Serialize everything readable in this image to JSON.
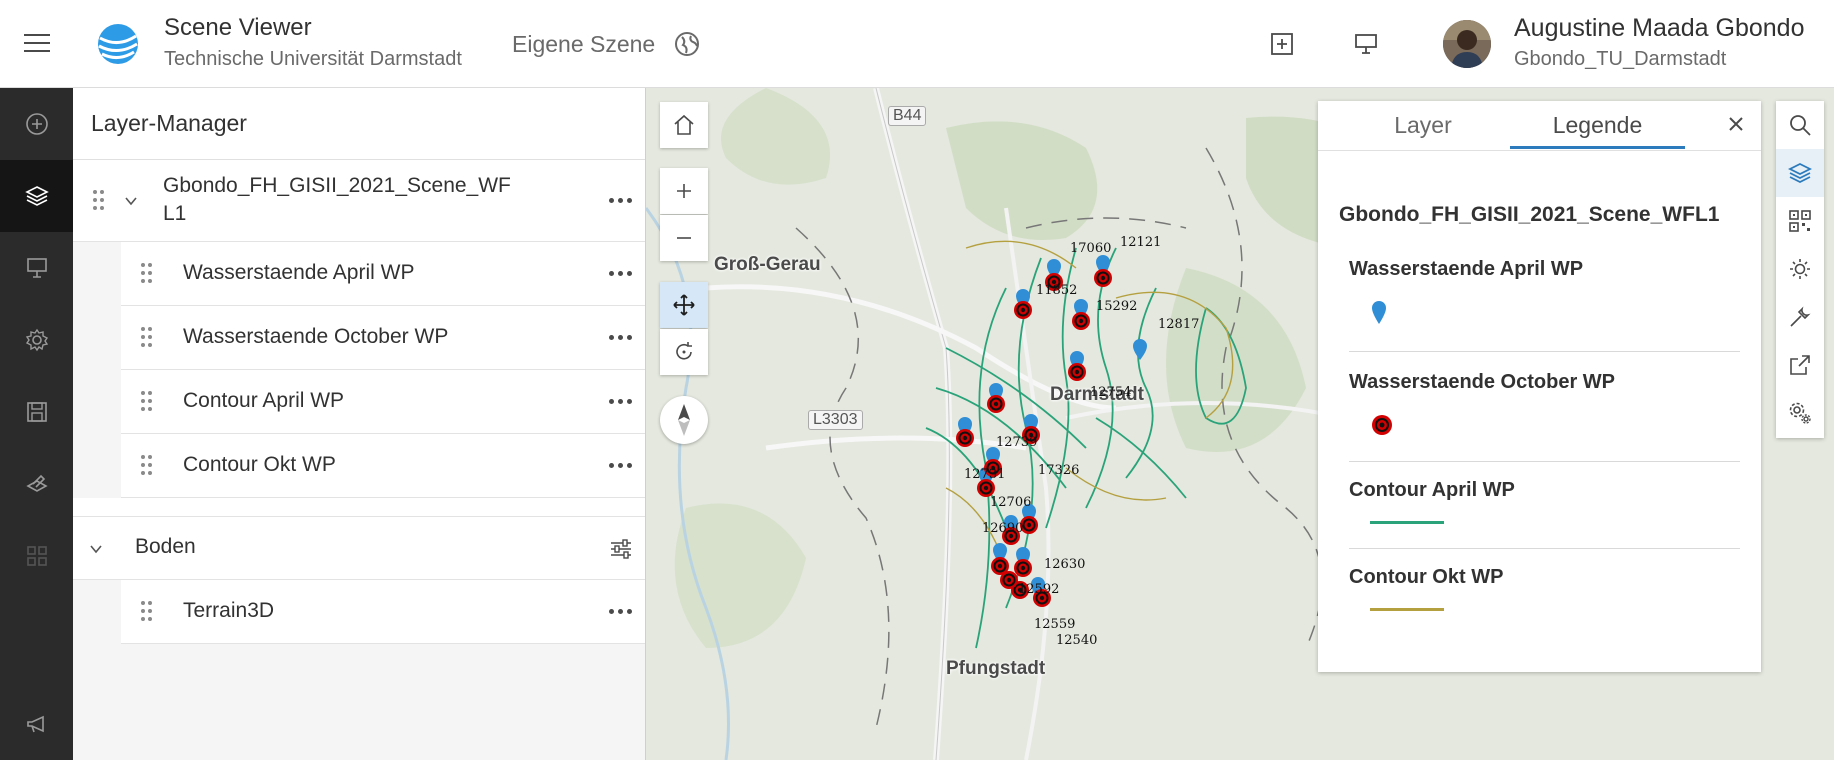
{
  "header": {
    "app_title": "Scene Viewer",
    "app_subtitle": "Technische Universität Darmstadt",
    "scene_name": "Eigene Szene",
    "user_name": "Augustine Maada Gbondo",
    "user_id": "Gbondo_TU_Darmstadt",
    "icons": [
      "menu-icon",
      "globe-icon",
      "add-icon",
      "presentation-icon"
    ]
  },
  "rail": {
    "icons": [
      "add-circle-icon",
      "layers-icon",
      "slides-icon",
      "settings-icon",
      "save-icon",
      "analysis-icon",
      "grid-icon",
      "megaphone-icon"
    ],
    "active": "layers-icon"
  },
  "layer_manager": {
    "title": "Layer-Manager",
    "group1": {
      "label_line1": "Gbondo_FH_GISII_2021_Scene_WF",
      "label_line2": "L1",
      "children": [
        {
          "label": "Wasserstaende April WP"
        },
        {
          "label": "Wasserstaende October WP"
        },
        {
          "label": "Contour April WP"
        },
        {
          "label": "Contour Okt WP"
        }
      ]
    },
    "group2": {
      "label": "Boden",
      "children": [
        {
          "label": "Terrain3D"
        }
      ]
    }
  },
  "map": {
    "places": {
      "gross_gerau": "Groß-Gerau",
      "darmstadt": "Darmstadt",
      "pfungstadt": "Pfungstadt"
    },
    "roads": {
      "b44": "B44",
      "l3303": "L3303"
    },
    "well_labels": [
      "17060",
      "12121",
      "11852",
      "15292",
      "12817",
      "12754",
      "12739",
      "17326",
      "12731",
      "12706",
      "12690",
      "12630",
      "12592",
      "12559",
      "12540"
    ]
  },
  "legend": {
    "tabs": [
      "Layer",
      "Legende"
    ],
    "active_tab": "Legende",
    "layer_title": "Gbondo_FH_GISII_2021_Scene_WFL1",
    "items": [
      {
        "title": "Wasserstaende April WP",
        "symbol": "blue-pin",
        "color": "#2f8ed6"
      },
      {
        "title": "Wasserstaende October WP",
        "symbol": "red-black-dot",
        "color": "#d20000"
      },
      {
        "title": "Contour April WP",
        "symbol": "line",
        "color": "#2aa37a"
      },
      {
        "title": "Contour Okt WP",
        "symbol": "line",
        "color": "#b5a040"
      }
    ]
  },
  "tools": {
    "icons": [
      "search-icon",
      "layers-icon",
      "qr-icon",
      "daylight-icon",
      "wrench-icon",
      "share-icon",
      "settings-gears-icon"
    ],
    "active": "layers-icon"
  },
  "colors": {
    "accent": "#2b7bbd",
    "rail_bg": "#2b2b2b",
    "april_contour": "#2aa37a",
    "okt_contour": "#b5a040"
  }
}
